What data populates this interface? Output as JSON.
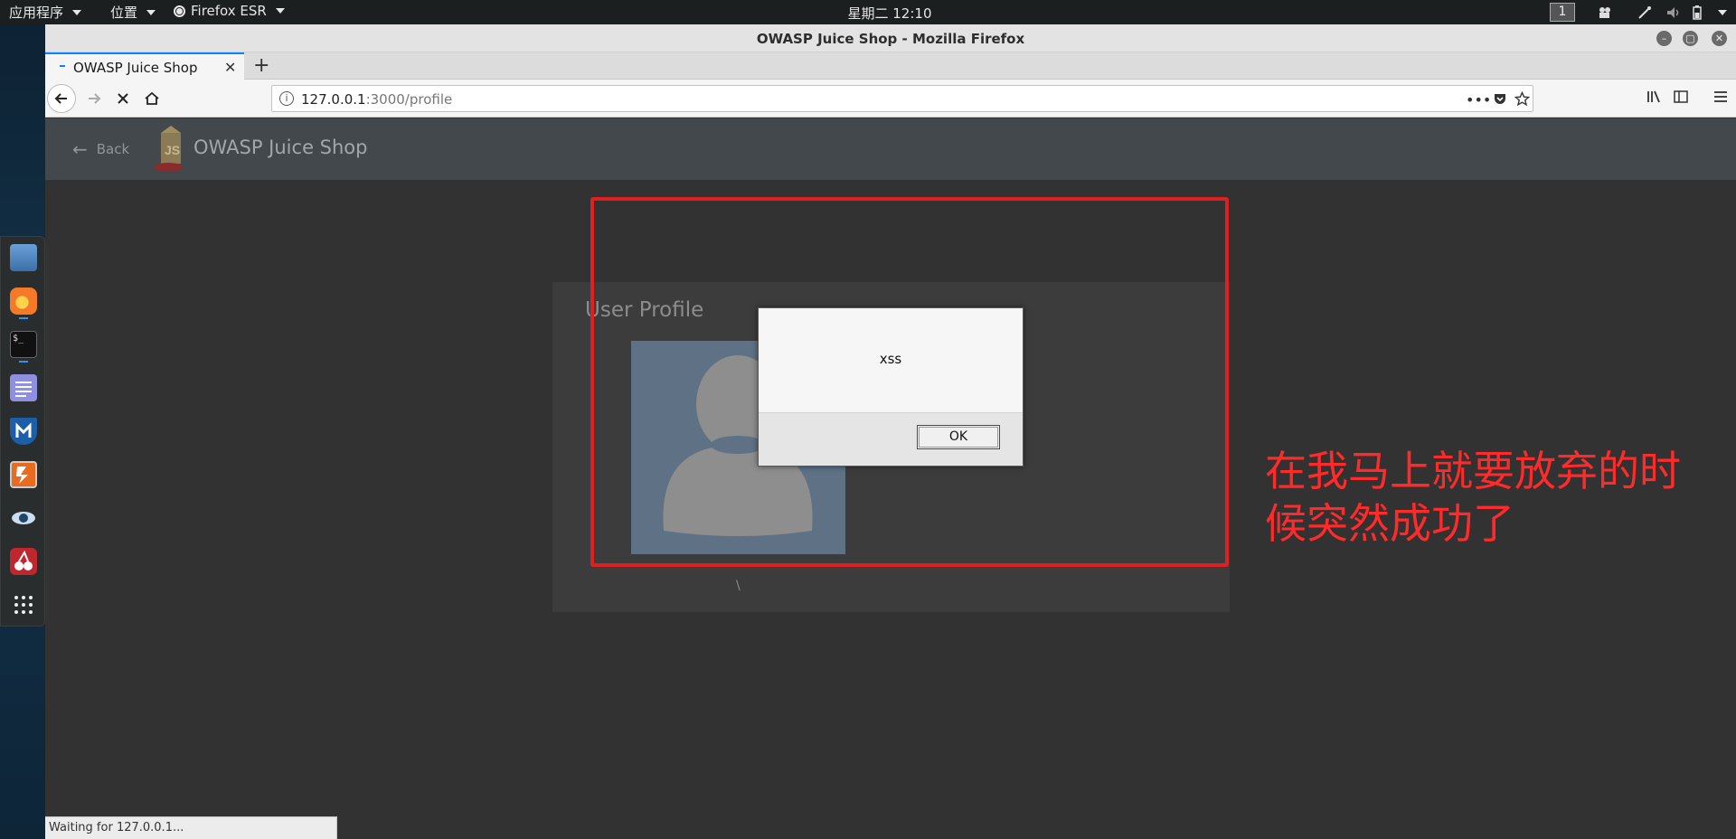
{
  "topbar": {
    "apps_label": "应用程序",
    "places_label": "位置",
    "firefox_label": "Firefox ESR",
    "clock": "星期二 12:10",
    "workspace": "1"
  },
  "window": {
    "title": "OWASP Juice Shop - Mozilla Firefox"
  },
  "tab": {
    "title": "OWASP Juice Shop",
    "close": "✕",
    "new_tab": "+"
  },
  "navbar": {
    "url_host": "127.0.0.1",
    "url_rest": ":3000/profile"
  },
  "app": {
    "back_label": "Back",
    "title": "OWASP Juice Shop"
  },
  "profile": {
    "title": "User Profile",
    "username_text": "\\"
  },
  "dialog": {
    "message": "xss",
    "ok_label": "OK"
  },
  "annotation": {
    "text": "在我马上就要放弃的时候突然成功了"
  },
  "status": {
    "text": "Waiting for 127.0.0.1..."
  },
  "colors": {
    "annotation_red": "#e02020",
    "toolbar": "#43484c",
    "page_bg": "#323232"
  }
}
